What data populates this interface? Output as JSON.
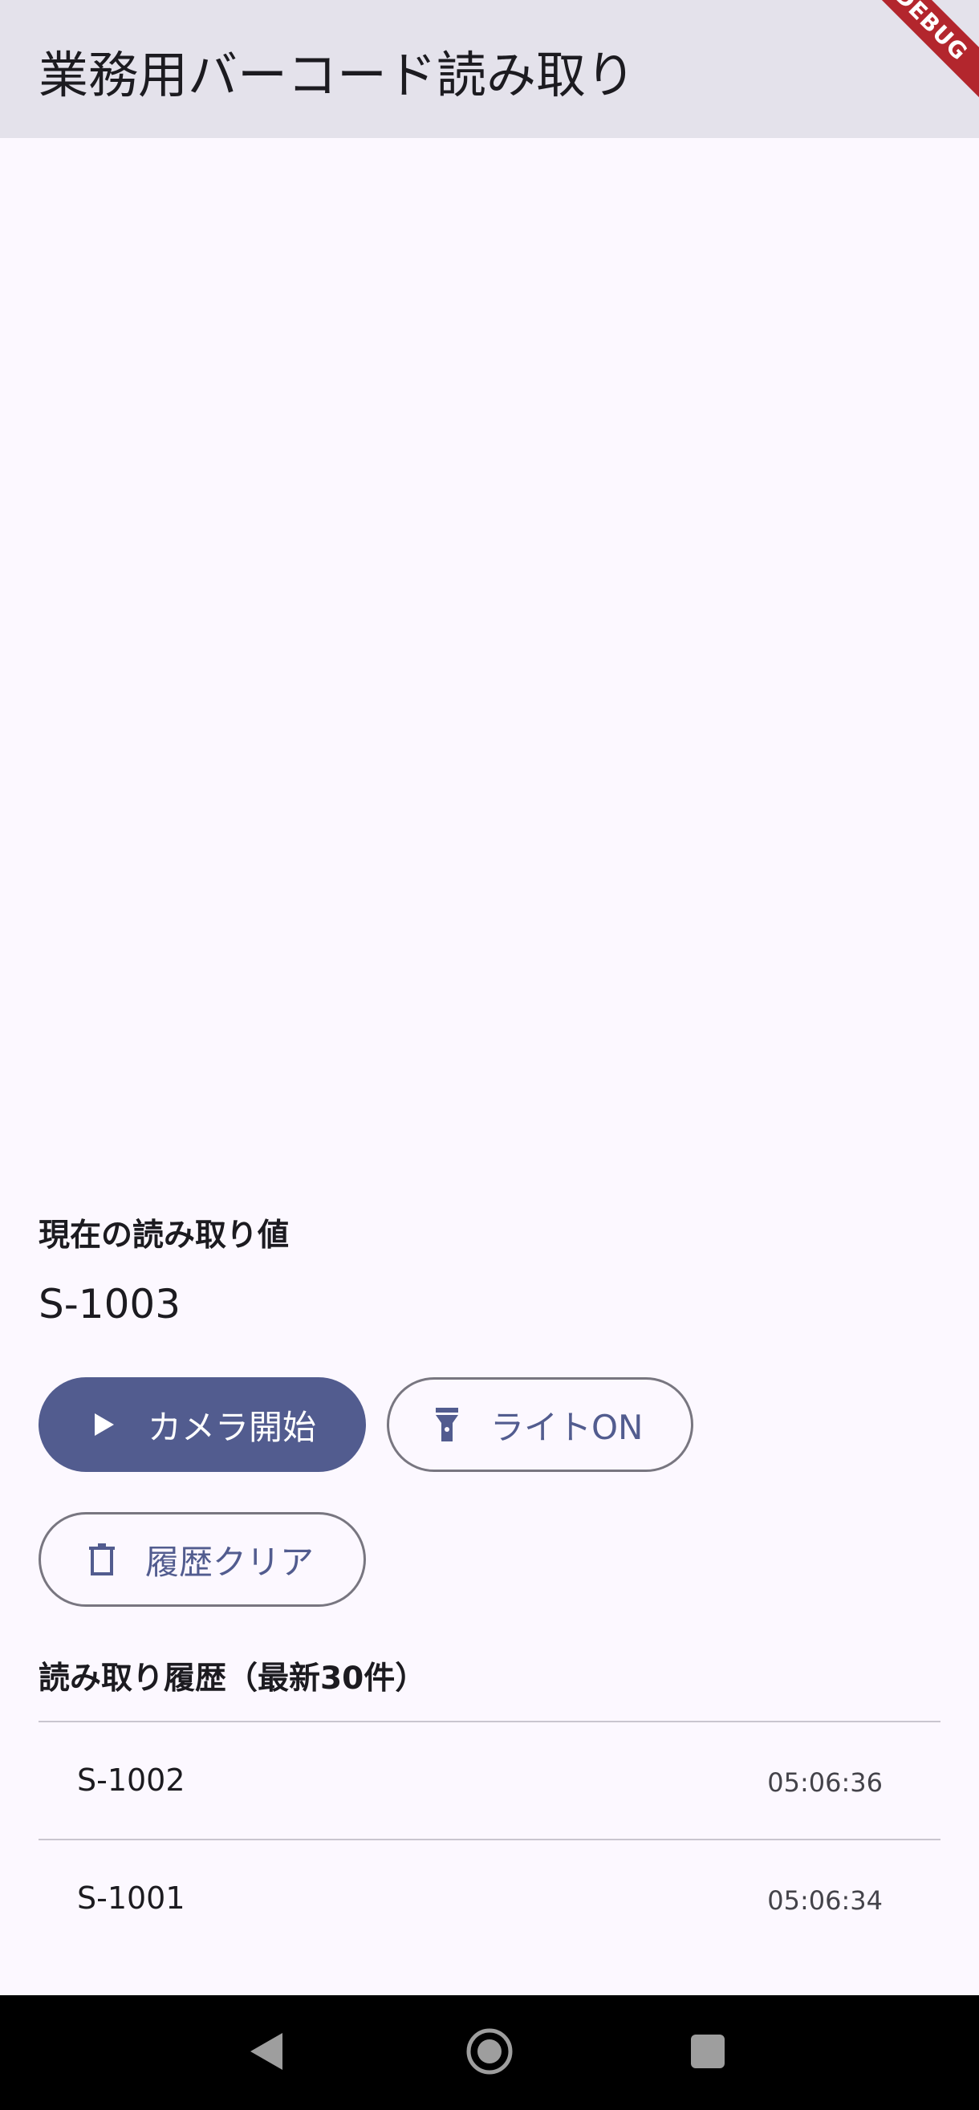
{
  "app_bar": {
    "title": "業務用バーコード読み取り",
    "debug_banner": "DEBUG"
  },
  "current": {
    "label": "現在の読み取り値",
    "value": "S-1003"
  },
  "buttons": {
    "camera_start": {
      "label": "カメラ開始",
      "icon": "play-icon"
    },
    "light_on": {
      "label": "ライトON",
      "icon": "flashlight-icon"
    },
    "clear_history": {
      "label": "履歴クリア",
      "icon": "trash-icon"
    }
  },
  "history": {
    "title": "読み取り履歴（最新30件）",
    "items": [
      {
        "code": "S-1002",
        "time": "05:06:36"
      },
      {
        "code": "S-1001",
        "time": "05:06:34"
      }
    ]
  },
  "colors": {
    "primary": "#525c8f",
    "app_bar_bg": "#e4e2eb",
    "background": "#fcf8ff",
    "debug_banner": "#b3262d"
  }
}
